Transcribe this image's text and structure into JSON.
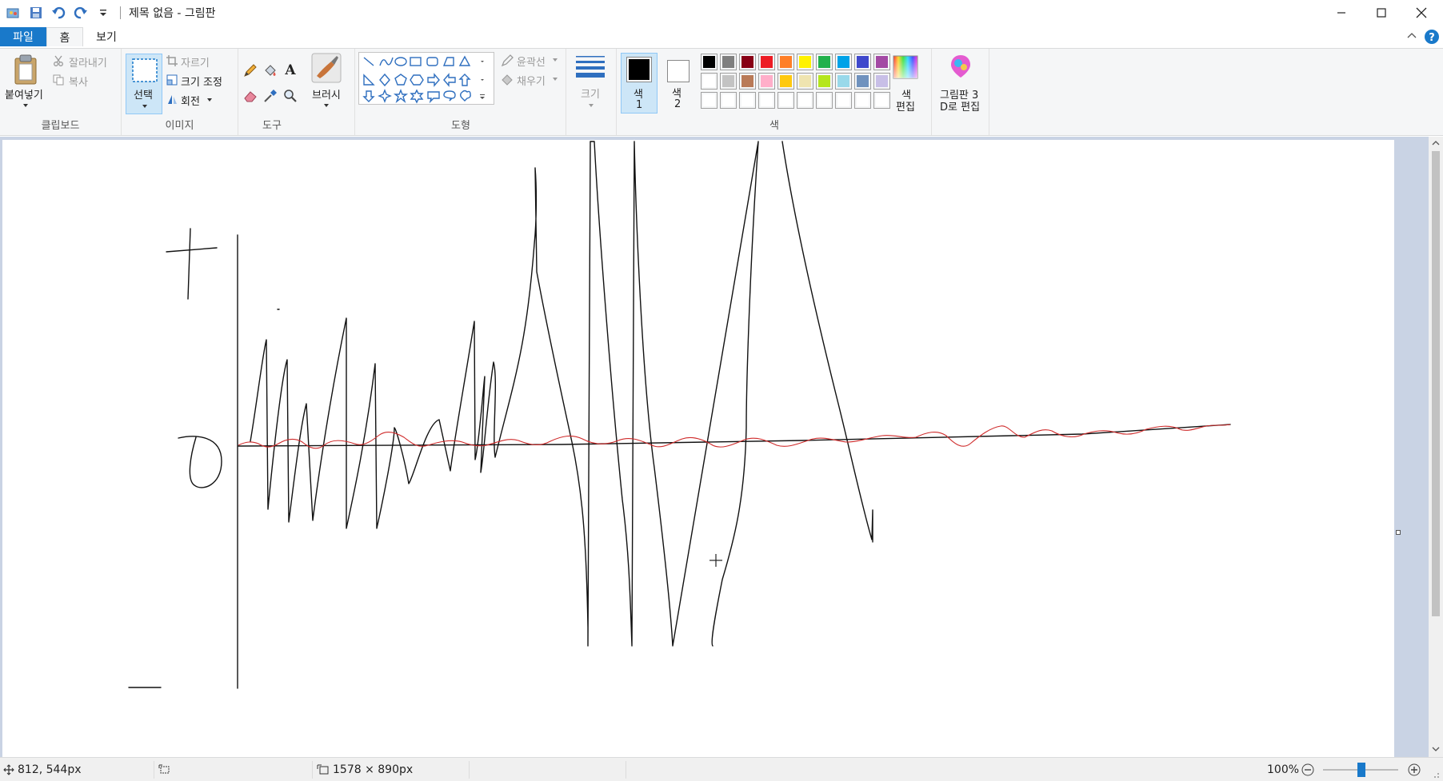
{
  "window": {
    "title": "제목 없음 - 그림판"
  },
  "tabs": [
    {
      "label": "파일"
    },
    {
      "label": "홈"
    },
    {
      "label": "보기"
    }
  ],
  "clipboard": {
    "paste_label": "붙여넣기",
    "cut_label": "잘라내기",
    "copy_label": "복사",
    "group_label": "클립보드"
  },
  "image": {
    "select_label": "선택",
    "crop_label": "자르기",
    "resize_label": "크기 조정",
    "rotate_label": "회전",
    "group_label": "이미지"
  },
  "tools": {
    "group_label": "도구",
    "brush_label": "브러시"
  },
  "shapes": {
    "group_label": "도형",
    "outline_label": "윤곽선",
    "fill_label": "채우기"
  },
  "size": {
    "label": "크기"
  },
  "colors": {
    "color1_line1": "색",
    "color1_line2": "1",
    "color2_line1": "색",
    "color2_line2": "2",
    "edit_line1": "색",
    "edit_line2": "편집",
    "group_label": "색",
    "color1_value": "#000000",
    "color2_value": "#ffffff",
    "palette_row1": [
      "#000000",
      "#7f7f7f",
      "#880015",
      "#ed1c24",
      "#ff7f27",
      "#fff200",
      "#22b14c",
      "#00a2e8",
      "#3f48cc",
      "#a349a4"
    ],
    "palette_row2": [
      "#ffffff",
      "#c3c3c3",
      "#b97a57",
      "#ffaec9",
      "#ffc90e",
      "#efe4b0",
      "#b5e61d",
      "#99d9ea",
      "#7092be",
      "#c8bfe7"
    ]
  },
  "paint3d": {
    "line1": "그림판 3",
    "line2": "D로 편집"
  },
  "status": {
    "cursor_pos": "812, 544px",
    "canvas_size": "1578 × 890px",
    "zoom": "100%"
  },
  "accent": "#1979ca"
}
